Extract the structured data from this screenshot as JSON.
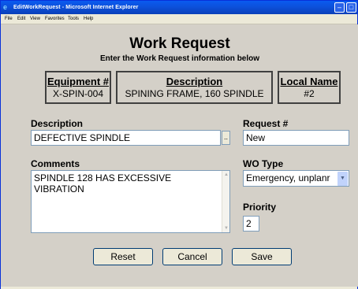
{
  "window": {
    "title": "EditWorkRequest - Microsoft Internet Explorer",
    "menu": [
      "File",
      "Edit",
      "View",
      "Favorites",
      "Tools",
      "Help"
    ],
    "icons": {
      "app": "ie-icon",
      "minimize": "minimize-icon",
      "maximize": "maximize-icon"
    }
  },
  "page": {
    "title": "Work Request",
    "subtitle": "Enter the Work Request information below"
  },
  "equipment_info": {
    "equipment": {
      "label": "Equipment #",
      "value": "X-SPIN-004"
    },
    "description": {
      "label": "Description",
      "value": "SPINING FRAME, 160 SPINDLE"
    },
    "local_name": {
      "label": "Local Name",
      "value": "#2"
    }
  },
  "form": {
    "description": {
      "label": "Description",
      "value": "DEFECTIVE SPINDLE",
      "lookup_label": ".."
    },
    "request_number": {
      "label": "Request #",
      "value": "New"
    },
    "comments": {
      "label": "Comments",
      "value": "SPINDLE 128 HAS EXCESSIVE VIBRATION"
    },
    "wo_type": {
      "label": "WO Type",
      "value": "Emergency, unplanr"
    },
    "priority": {
      "label": "Priority",
      "value": "2"
    }
  },
  "buttons": {
    "reset": "Reset",
    "cancel": "Cancel",
    "save": "Save"
  },
  "colors": {
    "titlebar": "#0a5bf0",
    "form_background": "#d4d0c8",
    "border": "#404040"
  }
}
